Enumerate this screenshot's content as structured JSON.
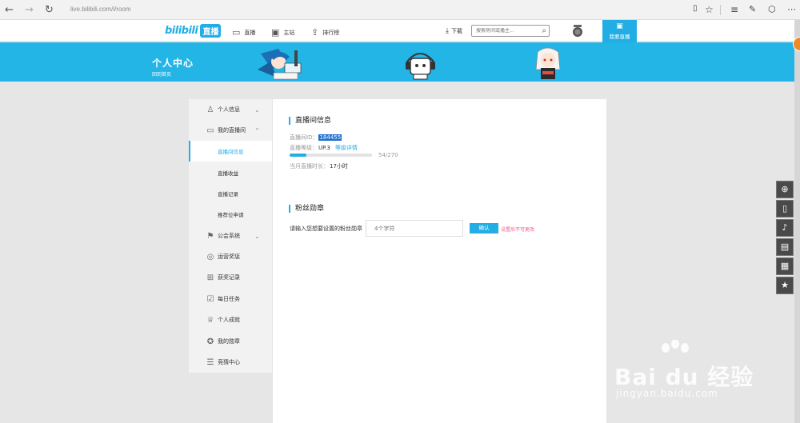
{
  "browser": {
    "url": "live.bilibili.com/i/room",
    "back_icon": "←",
    "forward_icon": "→",
    "refresh_icon": "↻"
  },
  "header": {
    "logo_bili": "bilibili",
    "logo_live": "直播",
    "nav": [
      {
        "icon": "monitor-icon",
        "label": "直播"
      },
      {
        "icon": "tv-icon",
        "label": "主站"
      },
      {
        "icon": "upload-icon",
        "label": "排行榜"
      }
    ],
    "download": "下载",
    "search_placeholder": "搜索房间或播主...",
    "go_live": "我要直播"
  },
  "banner": {
    "title": "个人中心",
    "back_link": "回到首页"
  },
  "sidebar": {
    "items": [
      {
        "label": "个人信息",
        "icon": "user-icon",
        "has_chevron": true
      },
      {
        "label": "我的直播间",
        "icon": "tv-icon",
        "has_chevron": true
      },
      {
        "label": "直播间信息",
        "sub": true,
        "active": true
      },
      {
        "label": "直播收益",
        "sub": true
      },
      {
        "label": "直播记录",
        "sub": true
      },
      {
        "label": "推荐位申请",
        "sub": true
      },
      {
        "label": "公会系统",
        "icon": "guild-icon",
        "has_chevron": true
      },
      {
        "label": "运营奖惩",
        "icon": "medal-icon"
      },
      {
        "label": "获奖记录",
        "icon": "gift-icon"
      },
      {
        "label": "每日任务",
        "icon": "calendar-check-icon"
      },
      {
        "label": "个人成就",
        "icon": "trophy-icon"
      },
      {
        "label": "我的勋章",
        "icon": "badge-icon"
      },
      {
        "label": "竞猜中心",
        "icon": "list-icon"
      }
    ]
  },
  "room_info": {
    "section_title": "直播间信息",
    "room_id_label": "直播间ID：",
    "room_id": "184455",
    "level_label": "直播等级：",
    "level": "UP.3",
    "level_link": "等级详情",
    "progress_text": "54/270",
    "progress_fraction": 0.2,
    "duration_label": "当月直播时长：",
    "duration": "17小时"
  },
  "fan_medal": {
    "section_title": "粉丝勋章",
    "label": "请输入您想要设置的粉丝勋章",
    "input_placeholder": "4个字符",
    "confirm": "确认",
    "warning": "设置后不可更改"
  },
  "watermark": {
    "main": "Bai du 经验",
    "sub": "jingyan.baidu.com"
  },
  "colors": {
    "accent": "#23ade5",
    "warning": "#f25d8e",
    "sidebar_bg": "#f2f2f2"
  }
}
